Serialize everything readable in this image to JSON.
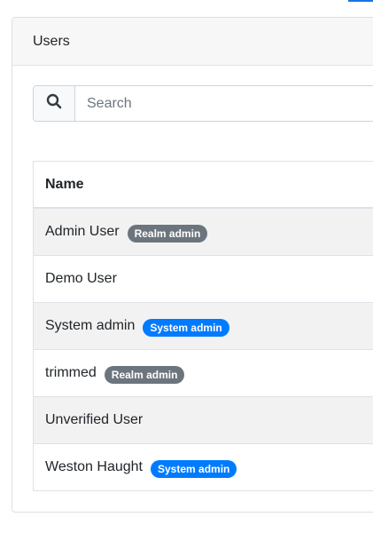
{
  "card": {
    "title": "Users"
  },
  "search": {
    "placeholder": "Search",
    "value": ""
  },
  "table": {
    "header": "Name",
    "rows": [
      {
        "name": "Admin User",
        "badge": "Realm admin",
        "badge_type": "realm"
      },
      {
        "name": "Demo User",
        "badge": "",
        "badge_type": ""
      },
      {
        "name": "System admin",
        "badge": "System admin",
        "badge_type": "system"
      },
      {
        "name": "trimmed",
        "badge": "Realm admin",
        "badge_type": "realm"
      },
      {
        "name": "Unverified User",
        "badge": "",
        "badge_type": ""
      },
      {
        "name": "Weston Haught",
        "badge": "System admin",
        "badge_type": "system"
      }
    ]
  },
  "colors": {
    "realm_badge": "#6c757d",
    "system_badge": "#007bff",
    "accent": "#1a73e8"
  },
  "icons": {
    "search": "search-icon"
  }
}
